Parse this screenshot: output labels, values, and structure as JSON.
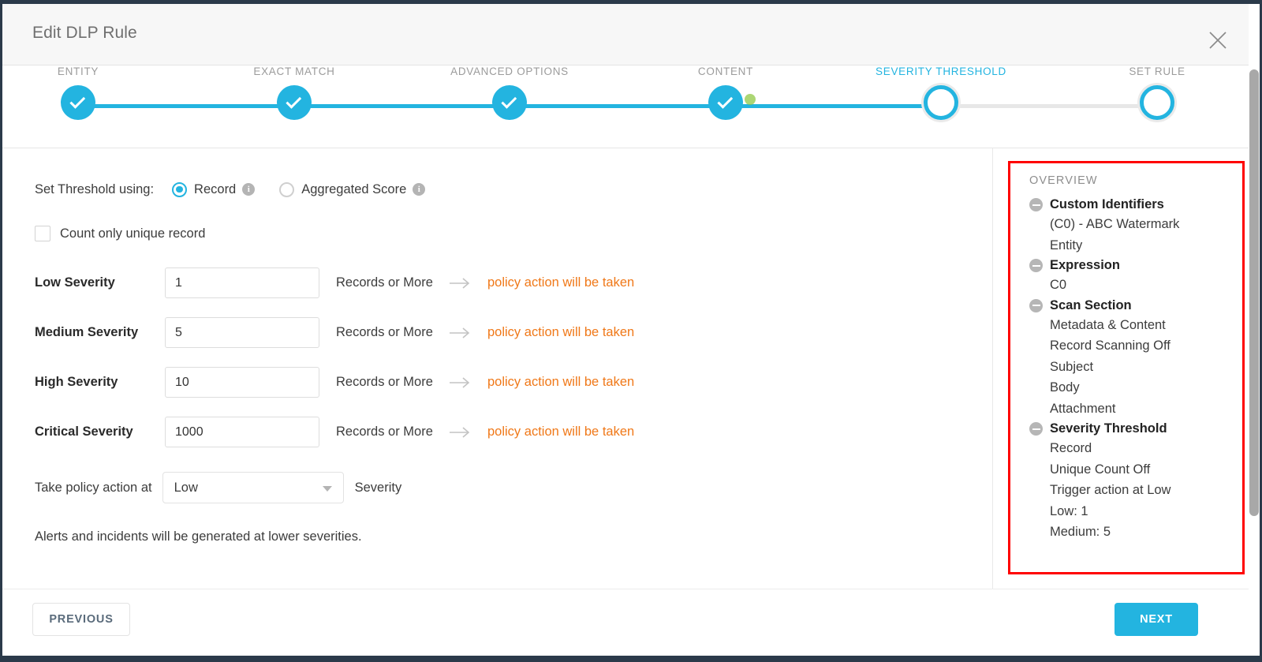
{
  "dialog": {
    "title": "Edit DLP Rule",
    "close_icon": "close-icon"
  },
  "stepper": {
    "steps": [
      {
        "label": "ENTITY",
        "state": "done"
      },
      {
        "label": "EXACT MATCH",
        "state": "done"
      },
      {
        "label": "ADVANCED OPTIONS",
        "state": "done"
      },
      {
        "label": "CONTENT",
        "state": "done"
      },
      {
        "label": "SEVERITY THRESHOLD",
        "state": "current"
      },
      {
        "label": "SET RULE",
        "state": "upcoming"
      }
    ]
  },
  "form": {
    "threshold_label": "Set Threshold using:",
    "options": [
      {
        "label": "Record",
        "selected": true,
        "info": "info-icon"
      },
      {
        "label": "Aggregated Score",
        "selected": false,
        "info": "info-icon"
      }
    ],
    "unique_record": {
      "label": "Count only unique record",
      "checked": false
    },
    "severities": [
      {
        "name": "Low Severity",
        "value": "1",
        "unit": "Records or More",
        "action": "policy action will be taken"
      },
      {
        "name": "Medium Severity",
        "value": "5",
        "unit": "Records or More",
        "action": "policy action will be taken"
      },
      {
        "name": "High Severity",
        "value": "10",
        "unit": "Records or More",
        "action": "policy action will be taken"
      },
      {
        "name": "Critical Severity",
        "value": "1000",
        "unit": "Records or More",
        "action": "policy action will be taken"
      }
    ],
    "policy_action": {
      "prefix": "Take policy action at",
      "selected": "Low",
      "suffix": "Severity"
    },
    "note": "Alerts and incidents will be generated at lower severities."
  },
  "overview": {
    "title": "OVERVIEW",
    "groups": [
      {
        "title": "Custom Identifiers",
        "items": [
          "(C0) - ABC Watermark",
          "Entity"
        ]
      },
      {
        "title": "Expression",
        "items": [
          "C0"
        ]
      },
      {
        "title": "Scan Section",
        "items": [
          "Metadata & Content",
          "Record Scanning Off",
          "Subject",
          "Body",
          "Attachment"
        ]
      },
      {
        "title": "Severity Threshold",
        "items": [
          "Record",
          "Unique Count Off",
          "Trigger action at Low",
          "Low: 1",
          "Medium: 5"
        ]
      }
    ]
  },
  "footer": {
    "previous_label": "PREVIOUS",
    "next_label": "NEXT"
  },
  "colors": {
    "accent": "#23b4e0",
    "warning": "#f07818",
    "highlight_border": "#ff0000",
    "green_dot": "#8cc63f"
  }
}
